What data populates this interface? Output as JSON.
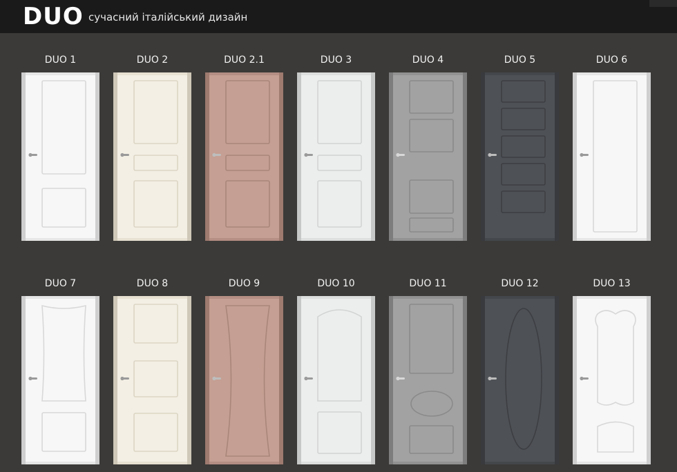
{
  "header": {
    "brand": "DUO",
    "tagline": "сучасний італійський дизайн"
  },
  "colors": {
    "background": "#3b3a38",
    "header": "#1a1a1a"
  },
  "rows": [
    [
      {
        "label": "DUO 1",
        "style": "white",
        "panels": "tall-top-low"
      },
      {
        "label": "DUO 2",
        "style": "cream",
        "panels": "raised-3"
      },
      {
        "label": "DUO 2.1",
        "style": "mocha",
        "panels": "raised-3"
      },
      {
        "label": "DUO 3",
        "style": "white-grey",
        "panels": "raised-3"
      },
      {
        "label": "DUO 4",
        "style": "grey",
        "panels": "four-equal"
      },
      {
        "label": "DUO 5",
        "style": "anthracite",
        "panels": "five-equal"
      },
      {
        "label": "DUO 6",
        "style": "white",
        "panels": "single"
      }
    ],
    [
      {
        "label": "DUO 7",
        "style": "white",
        "panels": "flared-top-low"
      },
      {
        "label": "DUO 8",
        "style": "cream",
        "panels": "three-stack"
      },
      {
        "label": "DUO 9",
        "style": "mocha",
        "panels": "hourglass"
      },
      {
        "label": "DUO 10",
        "style": "white-grey",
        "panels": "arched-top-low"
      },
      {
        "label": "DUO 11",
        "style": "grey",
        "panels": "oval-mid"
      },
      {
        "label": "DUO 12",
        "style": "anthracite",
        "panels": "tall-oval"
      },
      {
        "label": "DUO 13",
        "style": "white",
        "panels": "baroque"
      }
    ]
  ]
}
